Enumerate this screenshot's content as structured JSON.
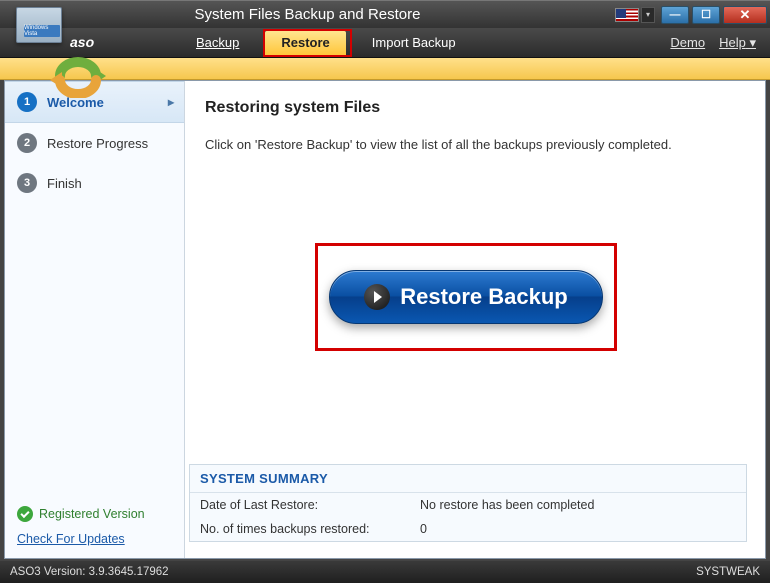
{
  "window": {
    "title": "System Files Backup and Restore",
    "brand": "aso",
    "drive_label": "Windows Vista"
  },
  "nav": {
    "backup": "Backup",
    "restore": "Restore",
    "import": "Import Backup",
    "demo": "Demo",
    "help": "Help"
  },
  "steps": [
    {
      "num": "1",
      "label": "Welcome"
    },
    {
      "num": "2",
      "label": "Restore Progress"
    },
    {
      "num": "3",
      "label": "Finish"
    }
  ],
  "sidebar": {
    "registered": "Registered Version",
    "updates": "Check For Updates"
  },
  "main": {
    "heading": "Restoring system Files",
    "desc": "Click on 'Restore Backup' to view the list of all the backups previously completed.",
    "button_label": "Restore Backup"
  },
  "summary": {
    "title": "SYSTEM SUMMARY",
    "last_restore_label": "Date of Last Restore:",
    "last_restore_value": "No restore has been completed",
    "count_label": "No. of times backups restored:",
    "count_value": "0"
  },
  "status": {
    "version": "ASO3 Version: 3.9.3645.17962",
    "watermark": "SYSTWEAK"
  }
}
